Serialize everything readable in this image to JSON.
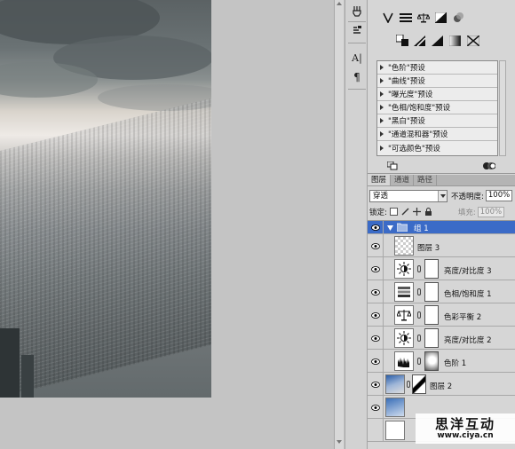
{
  "adjustments": {
    "presets": [
      "\"色阶\"预设",
      "\"曲线\"预设",
      "\"曝光度\"预设",
      "\"色相/饱和度\"预设",
      "\"黑白\"预设",
      "\"通道混和器\"预设",
      "\"可选颜色\"预设"
    ]
  },
  "layers_panel": {
    "tabs": [
      "图层",
      "通道",
      "路径"
    ],
    "blend_mode": "穿透",
    "opacity_label": "不透明度:",
    "opacity_value": "100%",
    "lock_label": "锁定:",
    "fill_label": "填充:",
    "fill_value": "100%",
    "layers": [
      {
        "name": "组 1",
        "type": "group",
        "selected": true
      },
      {
        "name": "图层 3",
        "type": "pixel"
      },
      {
        "name": "亮度/对比度 3",
        "type": "adjustment",
        "icon": "brightness-contrast-icon"
      },
      {
        "name": "色相/饱和度 1",
        "type": "adjustment",
        "icon": "hue-saturation-icon"
      },
      {
        "name": "色彩平衡 2",
        "type": "adjustment",
        "icon": "color-balance-icon"
      },
      {
        "name": "亮度/对比度 2",
        "type": "adjustment",
        "icon": "brightness-contrast-icon"
      },
      {
        "name": "色阶 1",
        "type": "adjustment",
        "icon": "levels-icon"
      },
      {
        "name": "图层 2",
        "type": "pixel-masked"
      }
    ]
  },
  "watermark": {
    "title": "思洋互动",
    "url": "www.ciya.cn"
  },
  "colors": {
    "selection": "#3b6bc7",
    "panel": "#d6d6d6"
  }
}
